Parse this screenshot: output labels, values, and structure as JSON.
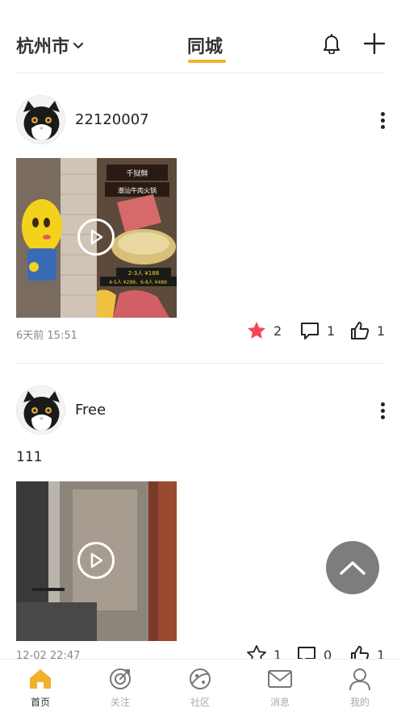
{
  "header": {
    "city": "杭州市",
    "title": "同城"
  },
  "posts": [
    {
      "username": "22120007",
      "time": "6天前 15:51",
      "favorites": "2",
      "comments": "1",
      "likes": "1",
      "video_overlay": {
        "line1": "千狱鲜",
        "line2": "潮汕牛肉火锅",
        "price1": "2-3人 ¥188",
        "price2": "4-5人 ¥299、6-8人 ¥489"
      }
    },
    {
      "username": "Free",
      "text": "111",
      "time": "12-02 22:47",
      "favorites": "1",
      "comments": "0",
      "likes": "1"
    }
  ],
  "tabbar": {
    "items": [
      {
        "label": "首页",
        "icon": "home-icon",
        "active": true
      },
      {
        "label": "关注",
        "icon": "target-icon"
      },
      {
        "label": "社区",
        "icon": "planet-icon"
      },
      {
        "label": "消息",
        "icon": "mail-icon"
      },
      {
        "label": "我的",
        "icon": "user-icon"
      }
    ]
  },
  "colors": {
    "accent": "#f2b12b",
    "star_active": "#f5455a",
    "scroll_top_bg": "#7d7d7d"
  }
}
